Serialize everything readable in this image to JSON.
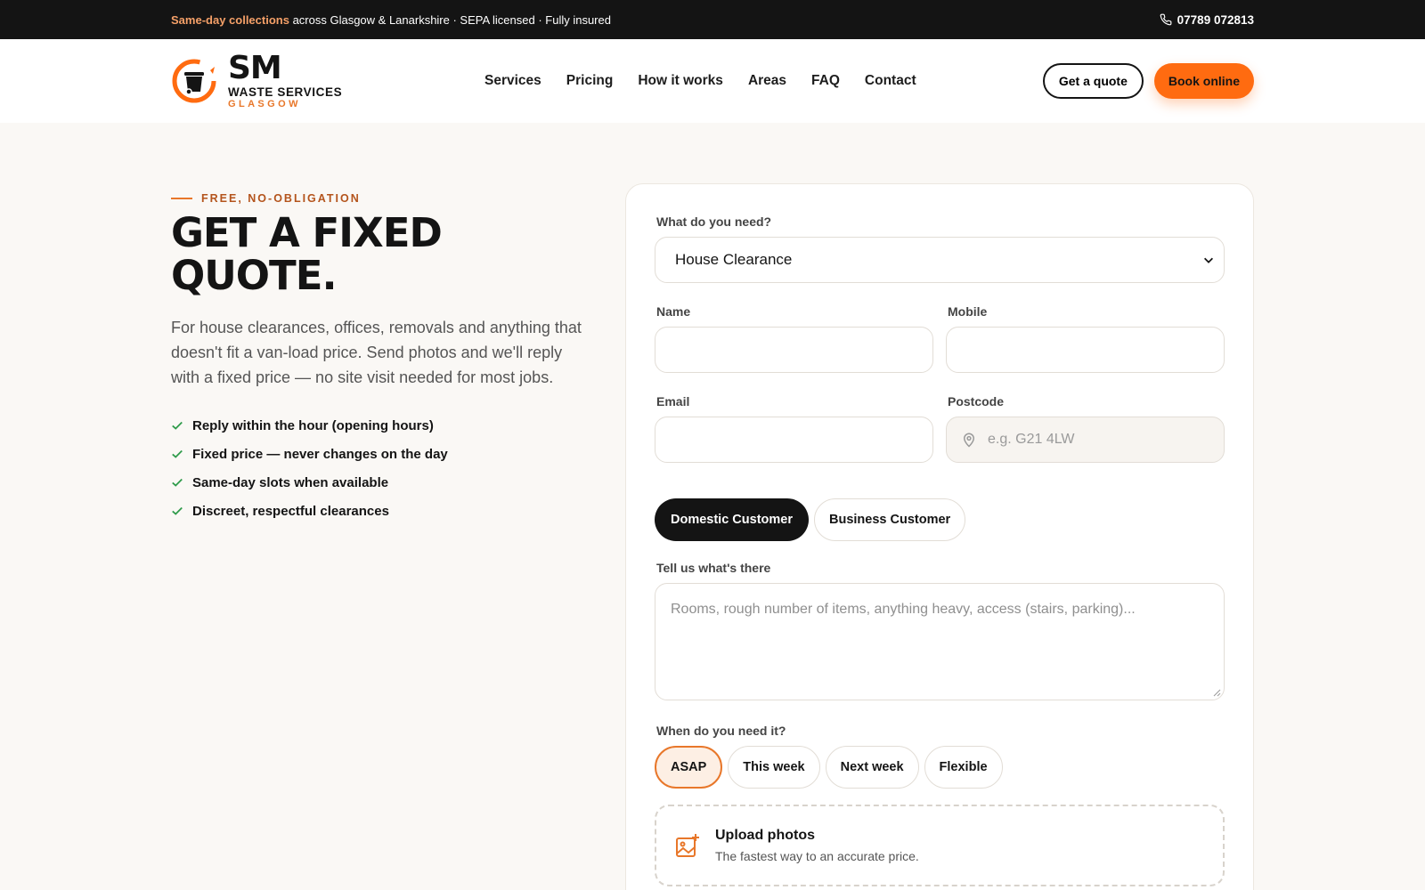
{
  "topbar": {
    "highlight": "Same-day collections",
    "message": " across Glasgow & Lanarkshire · SEPA licensed · Fully insured",
    "phone": "07789 072813"
  },
  "logo": {
    "line1": "SM",
    "line2": "WASTE SERVICES",
    "line3": "GLASGOW"
  },
  "nav": {
    "items": [
      "Services",
      "Pricing",
      "How it works",
      "Areas",
      "FAQ",
      "Contact"
    ]
  },
  "actions": {
    "quote": "Get a quote",
    "book": "Book online"
  },
  "hero": {
    "eyebrow": "FREE, NO-OBLIGATION",
    "title_line1": "GET A FIXED",
    "title_line2": "QUOTE.",
    "lead": "For house clearances, offices, removals and anything that doesn't fit a van-load price. Send photos and we'll reply with a fixed price — no site visit needed for most jobs.",
    "points": [
      "Reply within the hour (opening hours)",
      "Fixed price — never changes on the day",
      "Same-day slots when available",
      "Discreet, respectful clearances"
    ]
  },
  "form": {
    "need_label": "What do you need?",
    "need_value": "House Clearance",
    "name_label": "Name",
    "mobile_label": "Mobile",
    "email_label": "Email",
    "postcode_label": "Postcode",
    "postcode_placeholder": "e.g. G21 4LW",
    "customer_types": [
      "Domestic Customer",
      "Business Customer"
    ],
    "details_label": "Tell us what's there",
    "details_placeholder": "Rooms, rough number of items, anything heavy, access (stairs, parking)...",
    "when_label": "When do you need it?",
    "when_options": [
      "ASAP",
      "This week",
      "Next week",
      "Flexible"
    ],
    "upload_title": "Upload photos",
    "upload_sub": "The fastest way to an accurate price."
  },
  "colors": {
    "accent": "#ff6b10",
    "accent_dark": "#e8772a",
    "dark": "#141414",
    "bg": "#faf8f5"
  }
}
